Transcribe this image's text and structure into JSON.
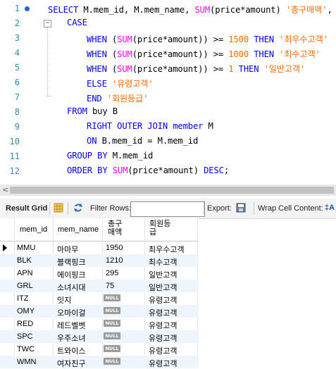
{
  "editor": {
    "lines": [
      {
        "n": "1"
      },
      {
        "n": "2"
      },
      {
        "n": "3"
      },
      {
        "n": "4"
      },
      {
        "n": "5"
      },
      {
        "n": "6"
      },
      {
        "n": "7"
      },
      {
        "n": "8"
      },
      {
        "n": "9"
      },
      {
        "n": "10"
      },
      {
        "n": "11"
      },
      {
        "n": "12"
      }
    ],
    "fold_symbol": "−",
    "tok": {
      "select": "SELECT",
      "l1_cols": " M.mem_id, M.mem_name, ",
      "sum": "SUM",
      "l1_expr": "(price*amount) ",
      "l1_alias": "'총구매액'",
      "comma": ",",
      "case": "CASE",
      "when": "WHEN",
      "then": "THEN",
      "paren_open": " (",
      "cmp_ge": "(price*amount)) >= ",
      "n1500": "1500",
      "n1000": "1000",
      "n1": "1",
      "s_top": "'최우수고객'",
      "s_high": "'최수고객'",
      "s_normal": "'일반고객'",
      "else": "ELSE",
      "s_ghost": "'유령고객'",
      "end": "END",
      "s_grade": "'회원등급'",
      "from": "FROM",
      "from_rest": " buy B",
      "right_outer_join": "RIGHT OUTER JOIN",
      "member": " member",
      "alias_m": " M",
      "on": "ON",
      "on_rest": " B.mem_id = M.mem_id",
      "group_by": "GROUP BY",
      "group_rest": " M.mem_id",
      "order_by": "ORDER BY",
      "order_expr": "(price*amount) ",
      "desc": "DESC",
      "semicolon": ";"
    }
  },
  "scroll": {
    "left_arrow": "<"
  },
  "toolbar": {
    "result_grid": "Result Grid",
    "filter_rows": "Filter Rows:",
    "filter_value": "",
    "export": "Export:",
    "wrap_cell": "Wrap Cell Content:",
    "wrap_icon_glyph": "‡A"
  },
  "grid": {
    "columns": [
      "mem_id",
      "mem_name",
      "총구",
      "매액",
      "회원등",
      "급"
    ],
    "null_label": "NULL",
    "rows": [
      {
        "id": "MMU",
        "name": "마마무",
        "total": "1950",
        "grade": "최우수고객"
      },
      {
        "id": "BLK",
        "name": "블랙핑크",
        "total": "1210",
        "grade": "최수고객"
      },
      {
        "id": "APN",
        "name": "에이핑크",
        "total": "295",
        "grade": "일반고객"
      },
      {
        "id": "GRL",
        "name": "소녀시대",
        "total": "75",
        "grade": "일반고객"
      },
      {
        "id": "ITZ",
        "name": "잇지",
        "total": null,
        "grade": "유령고객"
      },
      {
        "id": "OMY",
        "name": "오마이걸",
        "total": null,
        "grade": "유령고객"
      },
      {
        "id": "RED",
        "name": "레드벨벳",
        "total": null,
        "grade": "유령고객"
      },
      {
        "id": "SPC",
        "name": "우주소녀",
        "total": null,
        "grade": "유령고객"
      },
      {
        "id": "TWC",
        "name": "트와이스",
        "total": null,
        "grade": "유령고객"
      },
      {
        "id": "WMN",
        "name": "여자친구",
        "total": null,
        "grade": "유령고객"
      }
    ]
  },
  "colors": {
    "keyword": "#0000ff",
    "function": "#ff00ff",
    "string": "#ff6a00",
    "line_number": "#2b91af",
    "row_alt": "#eef5fc"
  }
}
